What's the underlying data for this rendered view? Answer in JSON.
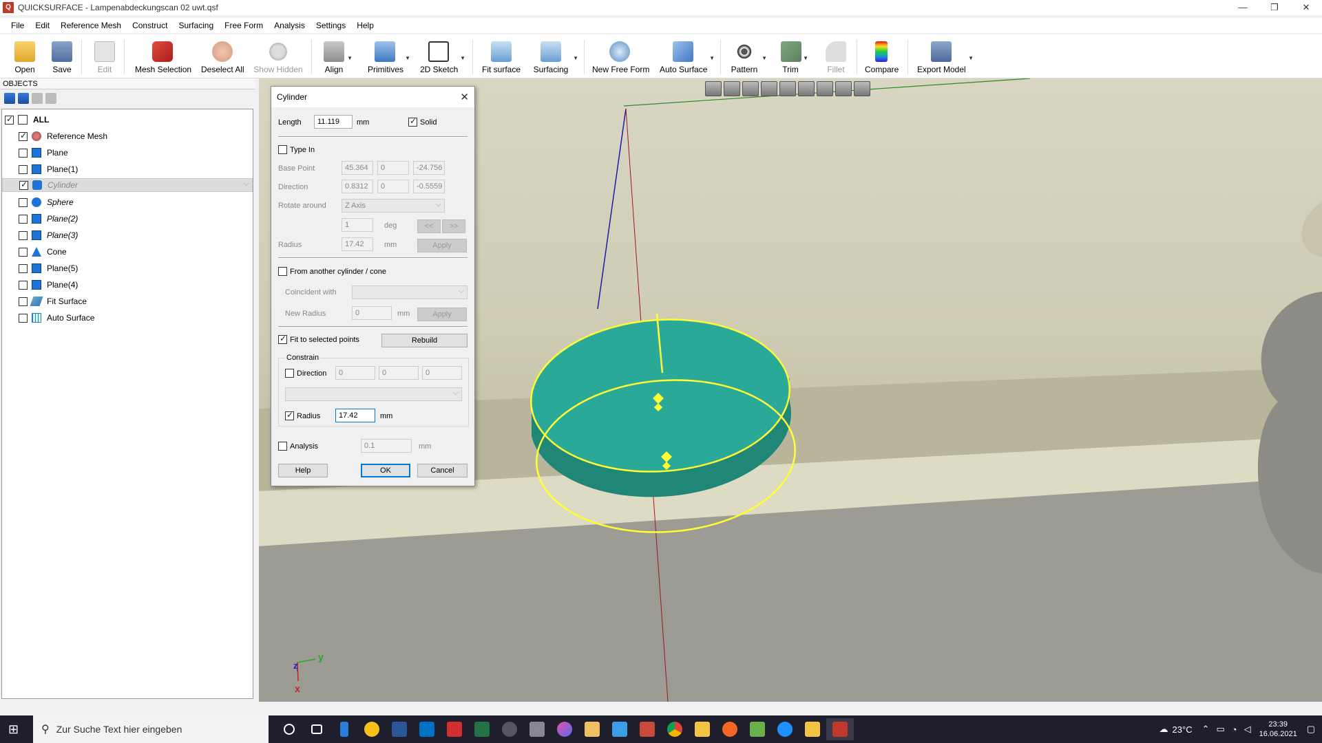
{
  "window": {
    "title": "QUICKSURFACE - Lampenabdeckungscan 02 uwt.qsf",
    "minimize": "—",
    "restore": "❐",
    "close": "✕"
  },
  "menu": [
    "File",
    "Edit",
    "Reference Mesh",
    "Construct",
    "Surfacing",
    "Free Form",
    "Analysis",
    "Settings",
    "Help"
  ],
  "toolbar": {
    "open": "Open",
    "save": "Save",
    "edit": "Edit",
    "mesh_selection": "Mesh Selection",
    "deselect_all": "Deselect All",
    "show_hidden": "Show Hidden",
    "align": "Align",
    "primitives": "Primitives",
    "sketch_2d": "2D Sketch",
    "fit_surface": "Fit surface",
    "surfacing": "Surfacing",
    "new_free_form": "New Free Form",
    "auto_surface": "Auto Surface",
    "pattern": "Pattern",
    "trim": "Trim",
    "fillet": "Fillet",
    "compare": "Compare",
    "export_model": "Export Model"
  },
  "objects": {
    "header": "OBJECTS",
    "items": [
      {
        "label": "ALL",
        "checked": true,
        "icon": "all-icon"
      },
      {
        "label": "Reference Mesh",
        "checked": true,
        "icon": "mesh-icon"
      },
      {
        "label": "Plane",
        "checked": false,
        "icon": "plane-icon"
      },
      {
        "label": "Plane(1)",
        "checked": false,
        "icon": "plane-icon"
      },
      {
        "label": "Cylinder",
        "checked": true,
        "icon": "cylinder-icon",
        "selected": true
      },
      {
        "label": "Sphere",
        "checked": false,
        "icon": "sphere-icon"
      },
      {
        "label": "Plane(2)",
        "checked": false,
        "icon": "plane-icon"
      },
      {
        "label": "Plane(3)",
        "checked": false,
        "icon": "plane-icon"
      },
      {
        "label": "Cone",
        "checked": false,
        "icon": "cone-icon"
      },
      {
        "label": "Plane(5)",
        "checked": false,
        "icon": "plane-icon"
      },
      {
        "label": "Plane(4)",
        "checked": false,
        "icon": "plane-icon"
      },
      {
        "label": "Fit Surface",
        "checked": false,
        "icon": "fit-surface-icon"
      },
      {
        "label": "Auto Surface",
        "checked": false,
        "icon": "auto-surface-icon"
      }
    ]
  },
  "dialog": {
    "title": "Cylinder",
    "length_label": "Length",
    "length_value": "11.119",
    "length_unit": "mm",
    "solid_label": "Solid",
    "solid_checked": true,
    "type_in_label": "Type In",
    "type_in_checked": false,
    "base_point_label": "Base Point",
    "base_point": [
      "45.364",
      "0",
      "-24.756"
    ],
    "direction_label": "Direction",
    "direction": [
      "0.8312",
      "0",
      "-0.5559"
    ],
    "rotate_label": "Rotate around",
    "rotate_value": "Z Axis",
    "deg_value": "1",
    "deg_unit": "deg",
    "prev": "<<",
    "next": ">>",
    "radius_label": "Radius",
    "radius_value": "17.42",
    "radius_unit": "mm",
    "apply": "Apply",
    "from_label": "From another cylinder / cone",
    "from_checked": false,
    "coincident_label": "Coincident with",
    "new_radius_label": "New Radius",
    "new_radius_value": "0",
    "new_radius_unit": "mm",
    "fit_label": "Fit to selected points",
    "fit_checked": true,
    "rebuild": "Rebuild",
    "constrain_label": "Constrain",
    "c_direction_label": "Direction",
    "c_direction_checked": false,
    "c_direction": [
      "0",
      "0",
      "0"
    ],
    "c_radius_label": "Radius",
    "c_radius_checked": true,
    "c_radius_value": "17.42",
    "c_radius_unit": "mm",
    "analysis_label": "Analysis",
    "analysis_checked": false,
    "analysis_value": "0.1",
    "analysis_unit": "mm",
    "help": "Help",
    "ok": "OK",
    "cancel": "Cancel"
  },
  "viewport": {
    "axis_y": "y",
    "axis_z": "z",
    "axis_x": "x"
  },
  "taskbar": {
    "search_placeholder": "Zur Suche Text hier eingeben",
    "temperature": "23°C",
    "time": "23:39",
    "date": "16.06.2021"
  },
  "colors": {
    "cylinder": "#2aa898",
    "highlight": "#ffff33",
    "accent": "#0078d7"
  }
}
